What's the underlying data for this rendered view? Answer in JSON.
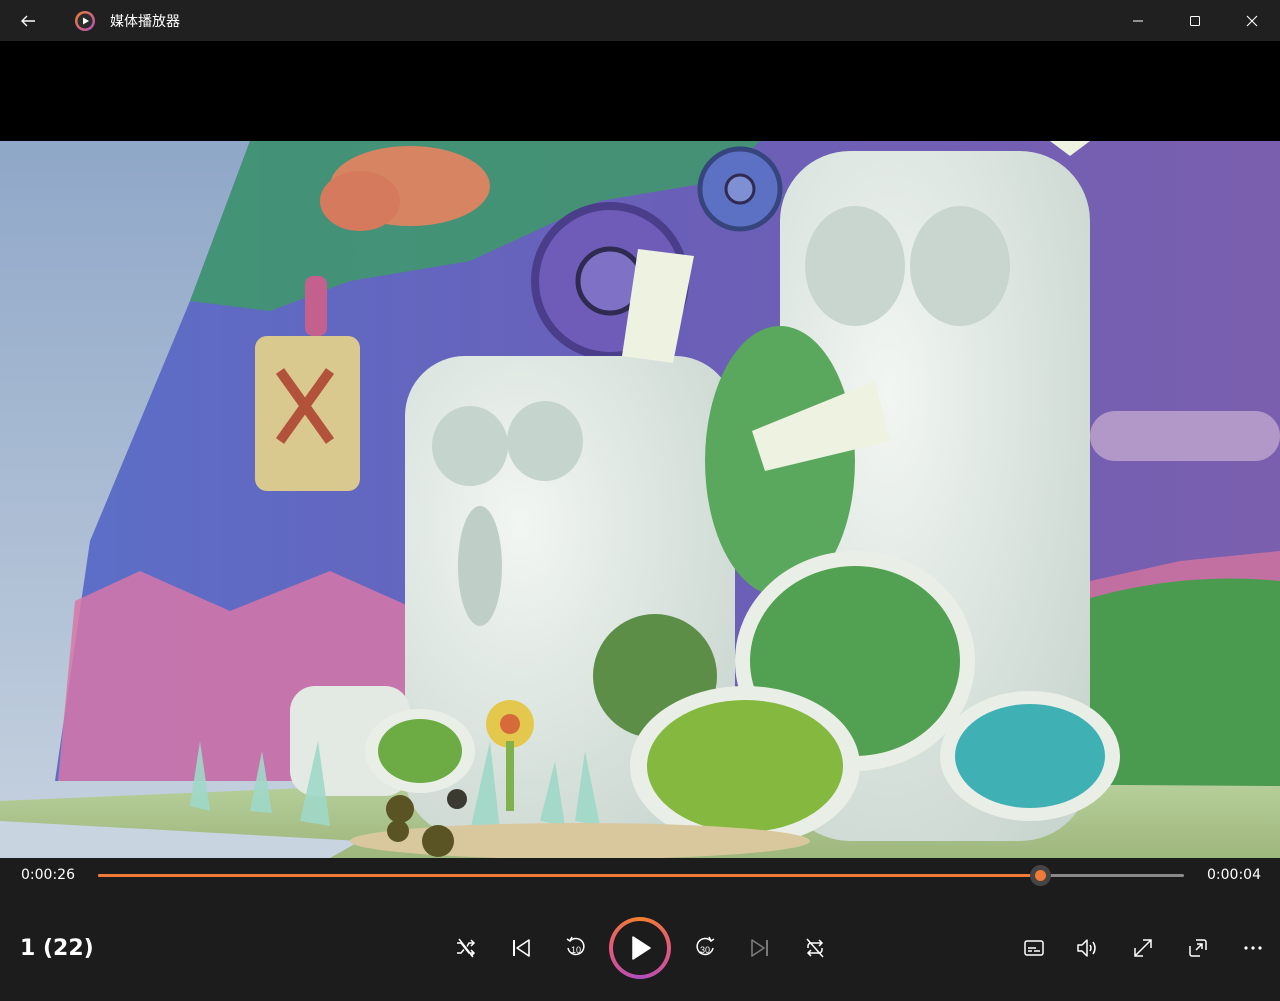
{
  "app": {
    "title": "媒体播放器",
    "back_icon": "back-arrow-icon",
    "app_icon": "media-player-logo-icon"
  },
  "window_controls": {
    "minimize_icon": "minimize-icon",
    "maximize_icon": "maximize-icon",
    "close_icon": "close-icon"
  },
  "playback": {
    "current_time": "0:00:26",
    "remaining_time": "0:00:04",
    "progress": 0.867,
    "playlist_label": "1 (22)"
  },
  "buttons": {
    "shuffle": "shuffle-icon",
    "previous": "previous-icon",
    "skip_back": "skip-back-10-icon",
    "skip_back_label": "10",
    "play": "play-icon",
    "skip_forward": "skip-forward-30-icon",
    "skip_forward_label": "30",
    "next": "next-icon",
    "repeat": "repeat-icon",
    "subtitles": "subtitles-icon",
    "volume": "volume-icon",
    "fullscreen": "fullscreen-icon",
    "mini_view": "mini-view-icon",
    "more": "more-icon"
  },
  "colors": {
    "accent": "#f07a36",
    "background": "#202020",
    "controls_background": "#1c1c1c"
  }
}
